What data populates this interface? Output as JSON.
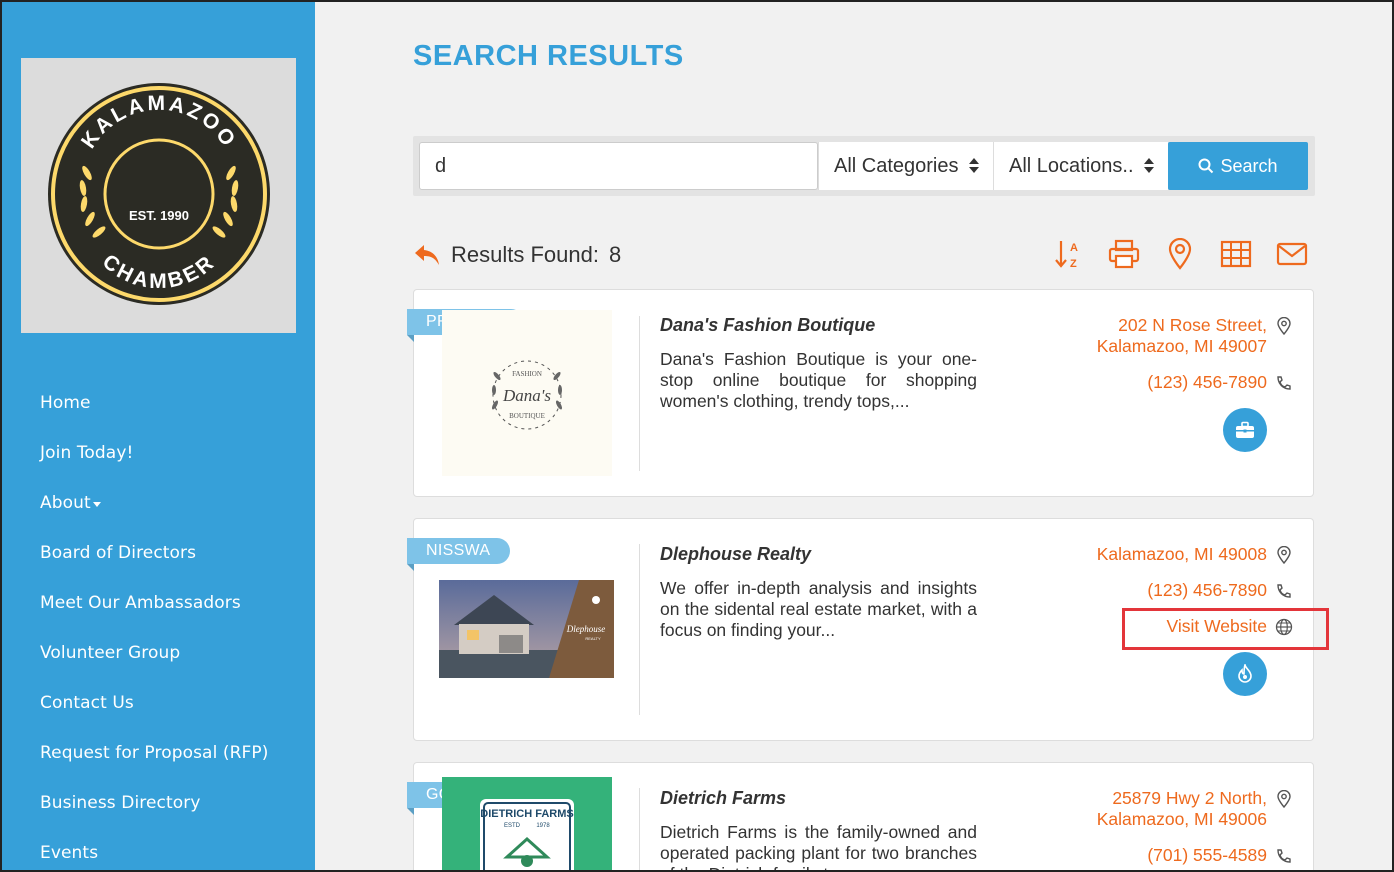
{
  "sidebar": {
    "logo": {
      "top_text": "KALAMAZOO",
      "center_text": "EST. 1990",
      "bottom_text": "CHAMBER",
      "colors": {
        "ring": "#fdd96b",
        "fill": "#2b2b24"
      }
    },
    "nav": [
      {
        "label": "Home"
      },
      {
        "label": "Join Today!"
      },
      {
        "label": "About",
        "has_dropdown": true
      },
      {
        "label": "Board of Directors"
      },
      {
        "label": "Meet Our Ambassadors"
      },
      {
        "label": "Volunteer Group"
      },
      {
        "label": "Contact Us"
      },
      {
        "label": "Request for Proposal (RFP)"
      },
      {
        "label": "Business Directory"
      },
      {
        "label": "Events"
      }
    ]
  },
  "main": {
    "title": "SEARCH RESULTS",
    "search": {
      "value": "d",
      "category": "All Categories",
      "location": "All Locations..",
      "button": "Search"
    },
    "results": {
      "label": "Results Found:",
      "count": "8"
    },
    "tools": [
      "sort-az-icon",
      "print-icon",
      "map-pin-icon",
      "grid-icon",
      "email-icon"
    ],
    "accent": "#ee6a1e",
    "listings": [
      {
        "badge": "PREMIUM",
        "name": "Dana's Fashion Boutique",
        "description": "Dana's Fashion Boutique is your one-stop online boutique for shopping women's clothing, trendy tops,...",
        "address_line1": "202 N Rose Street,",
        "address_line2": "Kalamazoo, MI 49007",
        "phone": "(123) 456-7890",
        "logo_text": {
          "top": "FASHION",
          "name": "Dana's",
          "bottom": "BOUTIQUE"
        }
      },
      {
        "badge": "NISSWA",
        "name": "Dlephouse Realty",
        "description": "We offer in-depth analysis and insights on the sidental real estate market, with a focus on finding your...",
        "address_line2": "Kalamazoo, MI 49008",
        "phone": "(123) 456-7890",
        "website": "Visit Website",
        "logo_text": {
          "name": "Dlephouse",
          "sub": "REALTY"
        }
      },
      {
        "badge": "GOLD",
        "name": "Dietrich Farms",
        "description": "Dietrich Farms is the family-owned and operated packing plant for two branches of the Dietrich family tree",
        "address_line1": "25879 Hwy 2 North,",
        "address_line2": "Kalamazoo, MI 49006",
        "phone": "(701) 555-4589",
        "logo_text": {
          "name": "DIETRICH FARMS",
          "estd": "ESTD",
          "year": "1978"
        }
      }
    ]
  }
}
